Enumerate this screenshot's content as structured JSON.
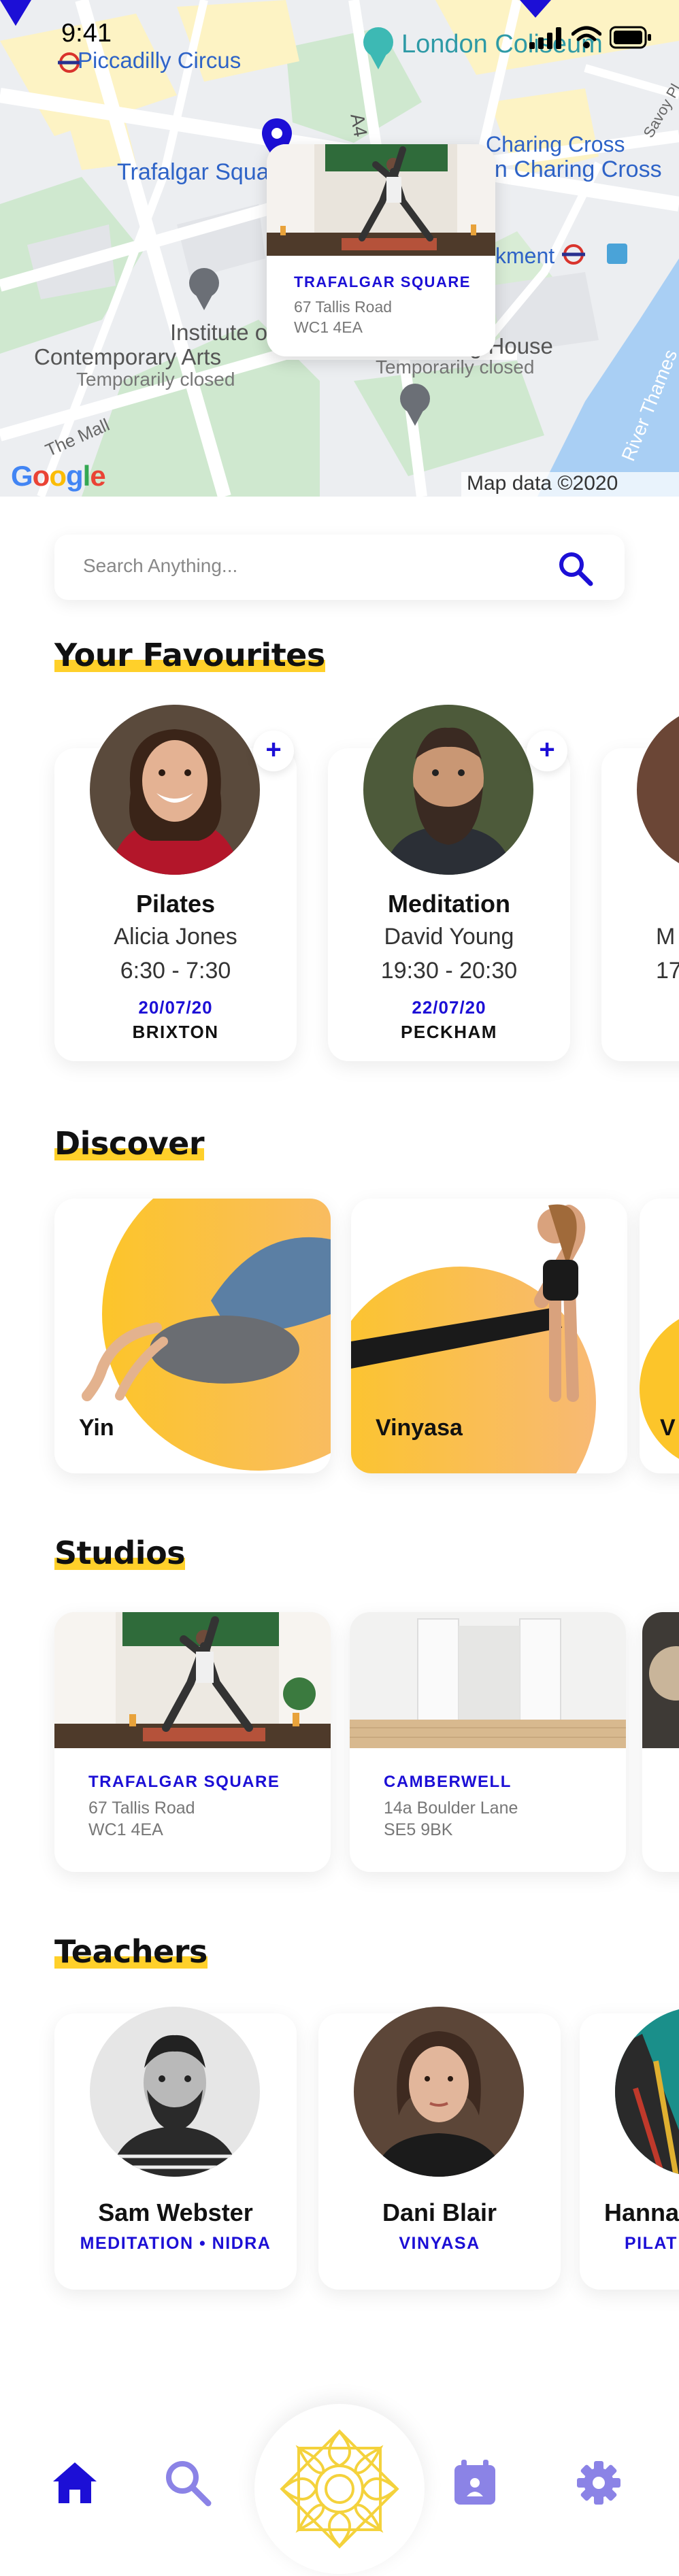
{
  "status_bar": {
    "time": "9:41"
  },
  "map": {
    "labels": {
      "piccadilly": "Piccadilly Circus",
      "london_coliseum": "London Coliseum",
      "trafalgar": "Trafalgar Square",
      "charing_cross": "Charing Cross",
      "charing_cross_2": "on Charing Cross",
      "embankment": "kment",
      "ica_1": "Institute of",
      "ica_2": "Contemporary Arts",
      "ica_3": "Temporarily closed",
      "house": "g House",
      "house_closed": "Temporarily closed",
      "the_mall": "The Mall",
      "savoy": "Savoy Pl",
      "thames": "River Thames",
      "a4": "A4"
    },
    "google": "Google",
    "credit": "Map data ©2020 Google",
    "popup": {
      "name": "TRAFALGAR SQUARE",
      "address_line1": "67 Tallis Road",
      "address_line2": "WC1 4EA"
    }
  },
  "search": {
    "placeholder": "Search Anything..."
  },
  "sections": {
    "favourites": "Your Favourites",
    "discover": "Discover",
    "studios": "Studios",
    "teachers": "Teachers"
  },
  "favourites": [
    {
      "class": "Pilates",
      "teacher": "Alicia Jones",
      "time": "6:30 - 7:30",
      "date": "20/07/20",
      "location": "BRIXTON",
      "add": "+"
    },
    {
      "class": "Meditation",
      "teacher": "David Young",
      "time": "19:30 - 20:30",
      "date": "22/07/20",
      "location": "PECKHAM",
      "add": "+"
    },
    {
      "class": "",
      "teacher": "M",
      "time": "17",
      "date": "",
      "location": "",
      "add": ""
    }
  ],
  "discover": [
    {
      "label": "Yin"
    },
    {
      "label": "Vinyasa"
    },
    {
      "label": "V"
    }
  ],
  "studios": [
    {
      "name": "TRAFALGAR SQUARE",
      "address_line1": "67 Tallis Road",
      "address_line2": "WC1 4EA"
    },
    {
      "name": "CAMBERWELL",
      "address_line1": "14a Boulder Lane",
      "address_line2": "SE5 9BK"
    }
  ],
  "teachers": [
    {
      "name": "Sam Webster",
      "tags": "MEDITATION • NIDRA"
    },
    {
      "name": "Dani Blair",
      "tags": "VINYASA"
    },
    {
      "name": "Hanna",
      "tags": "PILAT"
    }
  ],
  "bottom_nav": {
    "items": [
      {
        "icon": "home-icon",
        "active": true
      },
      {
        "icon": "search-icon",
        "active": false
      },
      {
        "icon": "mandala-logo",
        "active": false
      },
      {
        "icon": "calendar-icon",
        "active": false
      },
      {
        "icon": "gear-icon",
        "active": false
      }
    ]
  },
  "colors": {
    "accent_blue": "#1c0fd6",
    "highlight_yellow": "#ffd02a",
    "nav_inactive": "#8b83e6",
    "logo_gold": "#f4d23c"
  }
}
